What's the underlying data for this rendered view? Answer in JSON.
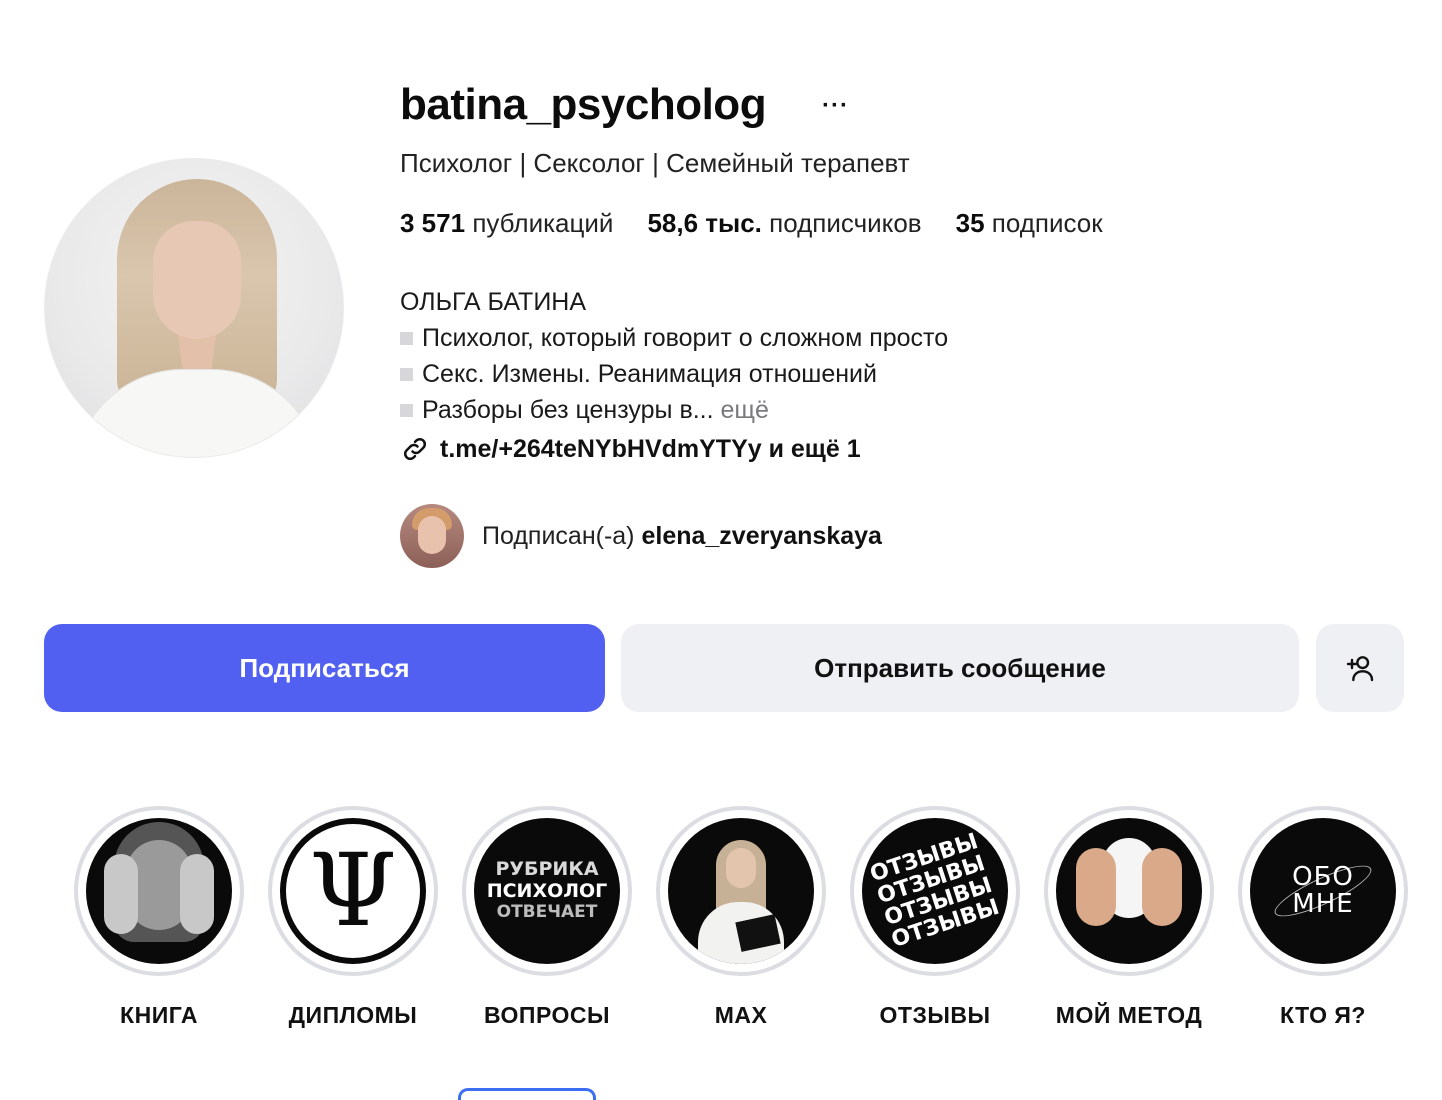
{
  "profile": {
    "username": "batina_psycholog",
    "more_label": "···",
    "category": "Психолог | Сексолог | Семейный терапевт",
    "stats": {
      "posts_count": "3 571",
      "posts_label": "публикаций",
      "followers_count": "58,6 тыс.",
      "followers_label": "подписчиков",
      "following_count": "35",
      "following_label": "подписок"
    },
    "bio": {
      "name": "ОЛЬГА БАТИНА",
      "line1": "Психолог, который говорит о сложном просто",
      "line2": "Секс. Измены. Реанимация отношений",
      "line3": "Разборы без цензуры в...",
      "more": "ещё"
    },
    "link": {
      "text": "t.me/+264teNYbHVdmYTYy и ещё 1",
      "icon": "link-icon"
    },
    "followed_by": {
      "prefix": "Подписан(-а)",
      "username": "elena_zveryanskaya"
    }
  },
  "actions": {
    "follow_label": "Подписаться",
    "message_label": "Отправить сообщение",
    "add_icon": "add-person-icon"
  },
  "highlights": [
    {
      "label": "КНИГА"
    },
    {
      "label": "ДИПЛОМЫ",
      "cover_text": "Ψ"
    },
    {
      "label": "ВОПРОСЫ",
      "cover_lines": [
        "РУБРИКА",
        "ПСИХОЛОГ",
        "ОТВЕЧАЕТ"
      ]
    },
    {
      "label": "MAX"
    },
    {
      "label": "ОТЗЫВЫ",
      "cover_text": "ОТЗЫВЫ"
    },
    {
      "label": "МОЙ МЕТОД"
    },
    {
      "label": "КТО Я?",
      "cover_lines": [
        "ОБО",
        "МНЕ"
      ]
    }
  ],
  "colors": {
    "follow_button": "#5160f0",
    "secondary_button": "#eff0f4",
    "highlight_ring": "#dcdde2",
    "muted_text": "#7a7a7e"
  }
}
